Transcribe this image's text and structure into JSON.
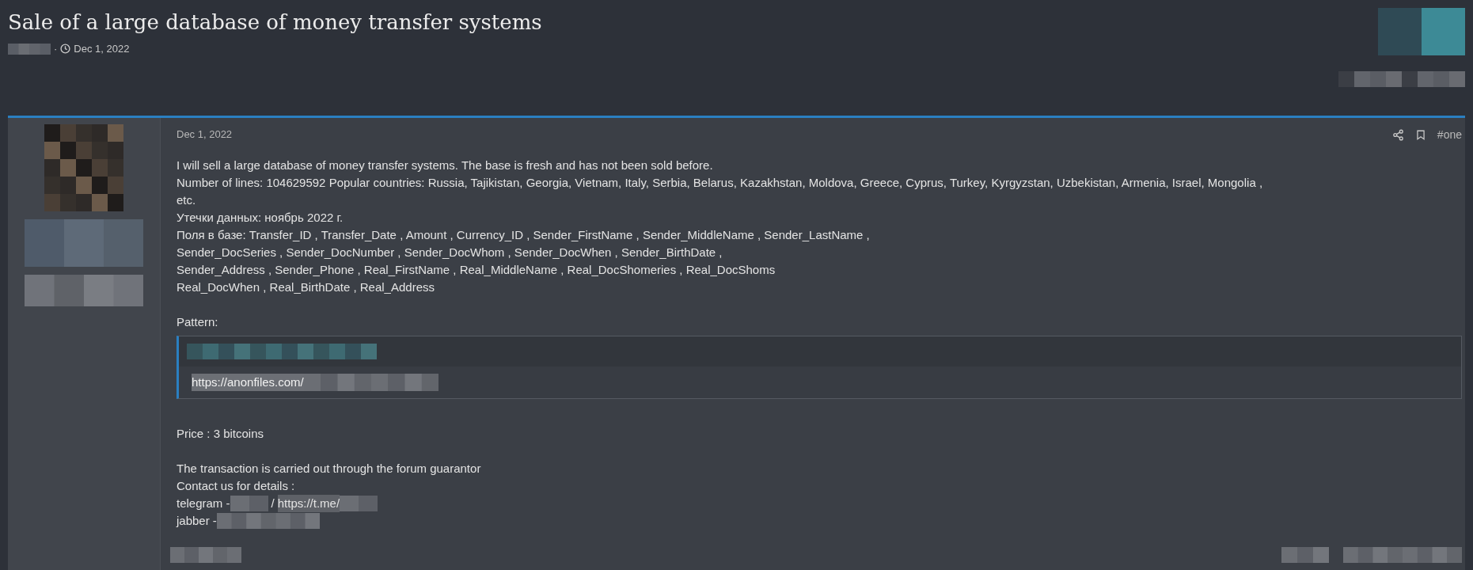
{
  "thread": {
    "title": "Sale of a large database of money transfer systems",
    "date": "Dec 1, 2022",
    "separator": "·"
  },
  "post": {
    "date": "Dec 1, 2022",
    "number": "#one",
    "intro": [
      "I will sell a large database of money transfer systems. The base is fresh and has not been sold before.",
      "Number of lines: 104629592 Popular countries: Russia, Tajikistan, Georgia, Vietnam, Italy, Serbia, Belarus, Kazakhstan, Moldova, Greece, Cyprus, Turkey, Kyrgyzstan, Uzbekistan, Armenia, Israel, Mongolia ,",
      "etc.",
      "Утечки данных: ноябрь 2022 г.",
      "Поля в базе: Transfer_ID , Transfer_Date , Amount , Currency_ID , Sender_FirstName , Sender_MiddleName , Sender_LastName ,",
      "Sender_DocSeries , Sender_DocNumber , Sender_DocWhom , Sender_DocWhen , Sender_BirthDate ,",
      "Sender_Address , Sender_Phone , Real_FirstName , Real_MiddleName , Real_DocShomeries , Real_DocShoms",
      "Real_DocWhen , Real_BirthDate , Real_Address"
    ],
    "pattern_label": "Pattern:",
    "quote_link": "https://anonfiles.com/",
    "price": "Price : 3 bitcoins",
    "outro": [
      "The transaction is carried out through the forum guarantor",
      "Contact us for details :"
    ],
    "telegram_label": "telegram -",
    "telegram_sep": "/",
    "telegram_link": "https://t.me/",
    "jabber_label": "jabber -"
  }
}
